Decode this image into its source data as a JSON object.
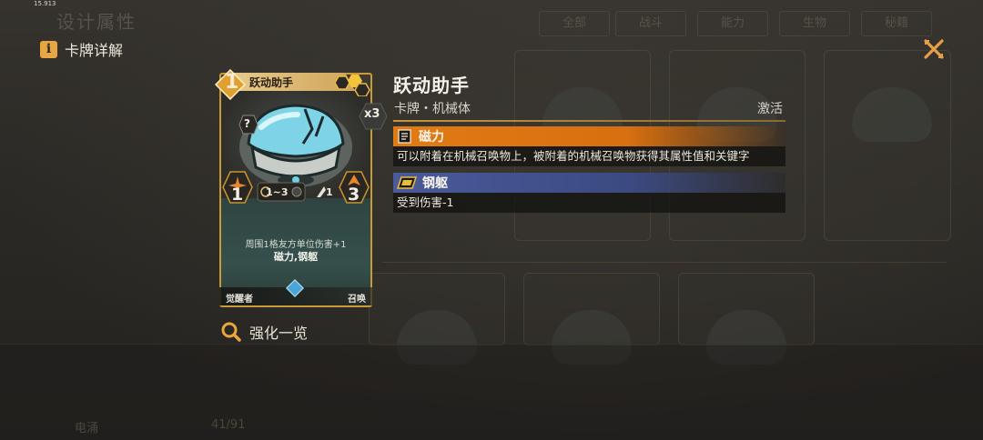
{
  "overlay": {
    "fps": "15.913",
    "title": "卡牌详解",
    "close_icon": "close-x-icon"
  },
  "background": {
    "title": "设计属性",
    "tabs": [
      "全部",
      "战斗",
      "能力",
      "生物",
      "秘籍"
    ],
    "bottom_label": "电涌",
    "bottom_count": "41/91"
  },
  "card": {
    "name": "跃动助手",
    "cost": "1",
    "count": "x3",
    "unknown_marker": "?",
    "attack": "1",
    "range": "1~3",
    "mini_value": "1",
    "health": "3",
    "description": "周围1格友方单位伤害+1",
    "keywords": "磁力,钢躯",
    "footer_left": "觉醒者",
    "footer_right": "召唤",
    "accent_color": "#c89a3a"
  },
  "detail": {
    "name": "跃动助手",
    "type_line": "卡牌・机械体",
    "status": "激活",
    "keywords": [
      {
        "title": "磁力",
        "icon": "document-icon",
        "color": "#e07b14",
        "description": "可以附着在机械召唤物上，被附着的机械召唤物获得其属性值和关键字"
      },
      {
        "title": "钢躯",
        "icon": "armor-plate-icon",
        "color": "#4a5a9a",
        "description": "受到伤害-1"
      }
    ]
  },
  "enhance": {
    "label": "强化一览",
    "icon": "search-icon"
  }
}
